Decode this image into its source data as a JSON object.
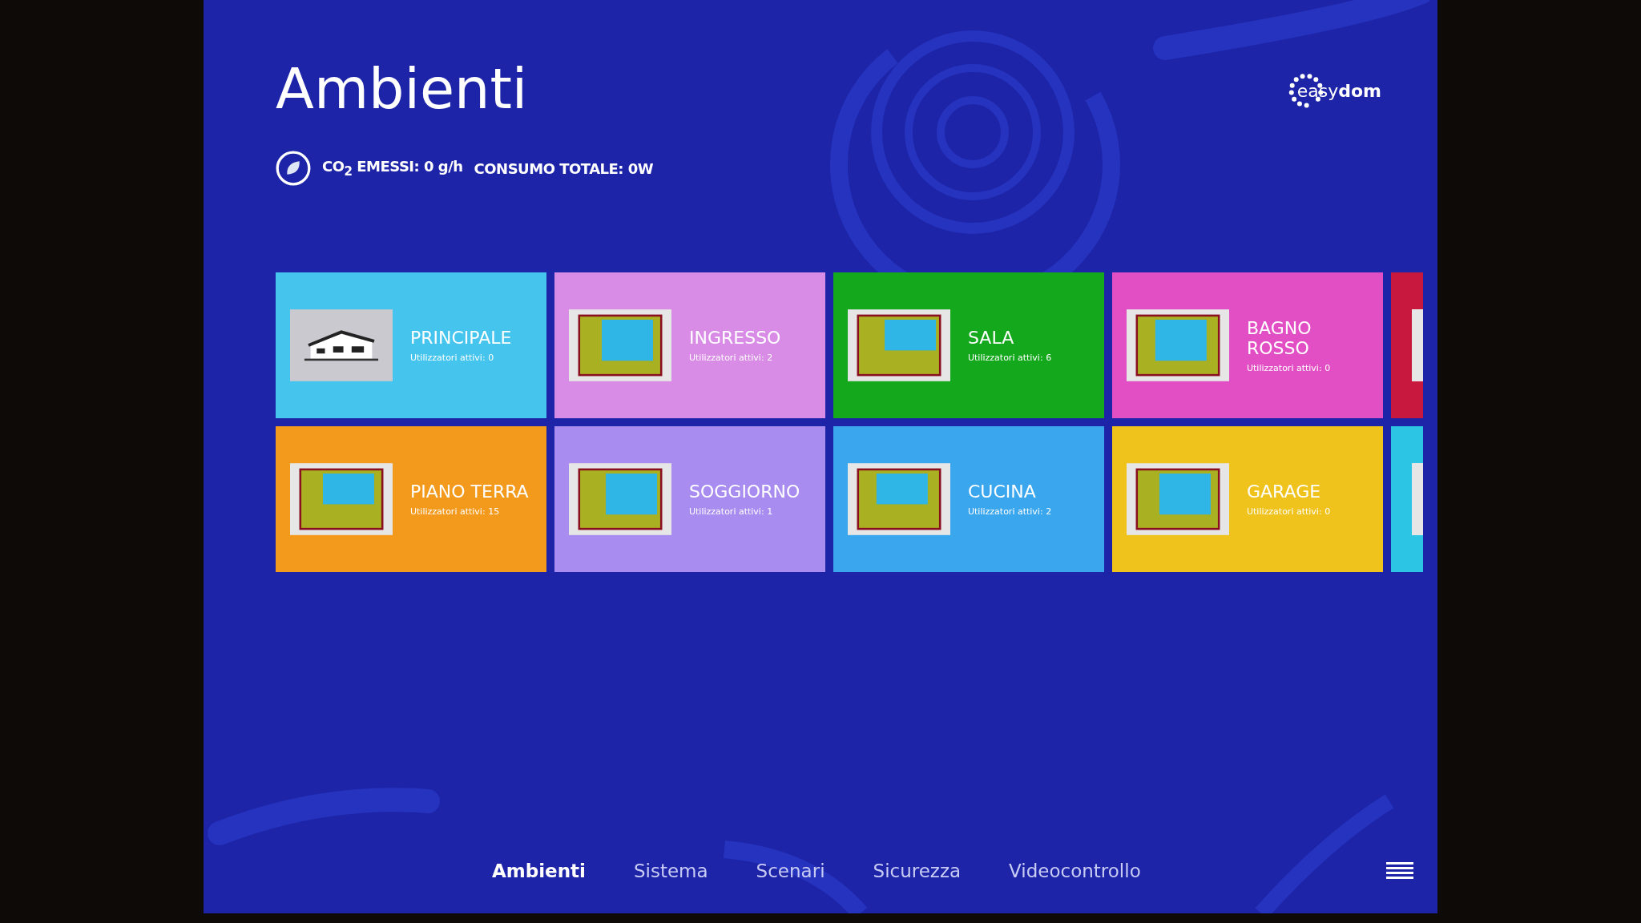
{
  "header": {
    "title": "Ambienti",
    "co2": "CO$_{2}$ EMESSI: 0 g/h",
    "consumption": "CONSUMO TOTALE: 0W",
    "logo": "easy**dom**"
  },
  "tiles": [
    {
      "name": "PRINCIPALE",
      "users": "Utilizzatori attivi: 0",
      "color": "#45c4ee",
      "kind": "house"
    },
    {
      "name": "INGRESSO",
      "users": "Utilizzatori attivi: 2",
      "color": "#d98ce6",
      "kind": "plan"
    },
    {
      "name": "SALA",
      "users": "Utilizzatori attivi: 6",
      "color": "#14a81c",
      "kind": "plan"
    },
    {
      "name": "BAGNO ROSSO",
      "users": "Utilizzatori attivi: 0",
      "color": "#e24fc4",
      "kind": "plan"
    },
    {
      "name": "PIANO TERRA",
      "users": "Utilizzatori attivi: 15",
      "color": "#f39a1c",
      "kind": "plan"
    },
    {
      "name": "SOGGIORNO",
      "users": "Utilizzatori attivi: 1",
      "color": "#a88cf0",
      "kind": "plan"
    },
    {
      "name": "CUCINA",
      "users": "Utilizzatori attivi: 2",
      "color": "#3aa6ee",
      "kind": "plan"
    },
    {
      "name": "GARAGE",
      "users": "Utilizzatori attivi: 0",
      "color": "#efc21c",
      "kind": "plan"
    }
  ],
  "partial_tiles": [
    {
      "color": "#c8183e"
    },
    {
      "color": "#2cc6e4"
    }
  ],
  "nav": [
    {
      "label": "Ambienti",
      "selected": true
    },
    {
      "label": "Sistema",
      "selected": false
    },
    {
      "label": "Scenari",
      "selected": false
    },
    {
      "label": "Sicurezza",
      "selected": false
    },
    {
      "label": "Videocontrollo",
      "selected": false
    }
  ]
}
